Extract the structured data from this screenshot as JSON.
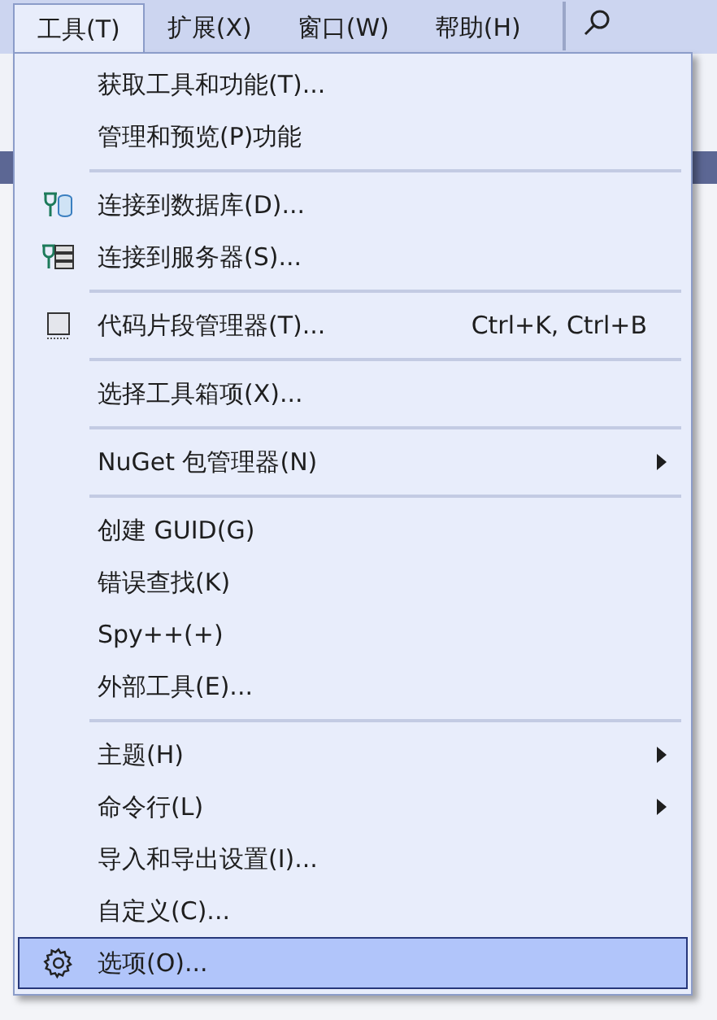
{
  "menubar": [
    {
      "label": "工具(T)",
      "selected": true
    },
    {
      "label": "扩展(X)",
      "selected": false
    },
    {
      "label": "窗口(W)",
      "selected": false
    },
    {
      "label": "帮助(H)",
      "selected": false
    }
  ],
  "menu": [
    {
      "kind": "plain",
      "label": "获取工具和功能(T)...",
      "selected": false
    },
    {
      "kind": "plain",
      "label": "管理和预览(P)功能",
      "selected": false
    },
    {
      "kind": "separator"
    },
    {
      "kind": "database",
      "label": "连接到数据库(D)...",
      "selected": false
    },
    {
      "kind": "server",
      "label": "连接到服务器(S)...",
      "selected": false
    },
    {
      "kind": "separator"
    },
    {
      "kind": "snippet",
      "label": "代码片段管理器(T)...",
      "shortcut": "Ctrl+K, Ctrl+B",
      "selected": false
    },
    {
      "kind": "separator"
    },
    {
      "kind": "plain",
      "label": "选择工具箱项(X)...",
      "selected": false
    },
    {
      "kind": "separator"
    },
    {
      "kind": "submenu",
      "label": "NuGet 包管理器(N)",
      "selected": false
    },
    {
      "kind": "separator"
    },
    {
      "kind": "plain",
      "label": "创建 GUID(G)",
      "selected": false
    },
    {
      "kind": "plain",
      "label": "错误查找(K)",
      "selected": false
    },
    {
      "kind": "plain",
      "label": "Spy++(+)",
      "selected": false
    },
    {
      "kind": "plain",
      "label": "外部工具(E)...",
      "selected": false
    },
    {
      "kind": "separator"
    },
    {
      "kind": "submenu",
      "label": "主题(H)",
      "selected": false
    },
    {
      "kind": "submenu",
      "label": "命令行(L)",
      "selected": false
    },
    {
      "kind": "plain",
      "label": "导入和导出设置(I)...",
      "selected": false
    },
    {
      "kind": "plain",
      "label": "自定义(C)...",
      "selected": false
    },
    {
      "kind": "gear",
      "label": "选项(O)...",
      "selected": true
    }
  ]
}
